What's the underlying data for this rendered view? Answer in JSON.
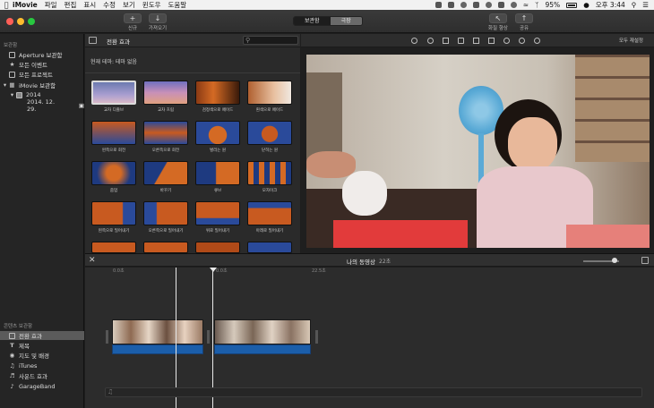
{
  "menubar": {
    "app_name": "iMovie",
    "items": [
      "파일",
      "편집",
      "표시",
      "수정",
      "보기",
      "윈도우",
      "도움말"
    ],
    "battery": "95%",
    "clock": "오후 3:44"
  },
  "toolbar": {
    "new_label": "신규",
    "import_label": "가져오기",
    "library_tab": "보관함",
    "theater_tab": "극장",
    "enhance_label": "화질 향상",
    "share_label": "공유"
  },
  "sidebar": {
    "library_header": "보관함",
    "items": [
      {
        "label": "Aperture 보관함"
      },
      {
        "label": "모든 이벤트"
      },
      {
        "label": "모든 프로젝트"
      },
      {
        "label": "iMovie 보관함"
      },
      {
        "label": "2014"
      },
      {
        "label": "2014. 12. 29."
      }
    ],
    "content_header": "콘텐츠 보관함",
    "content_items": [
      {
        "label": "전환 효과"
      },
      {
        "label": "제목"
      },
      {
        "label": "지도 및 배경"
      },
      {
        "label": "iTunes"
      },
      {
        "label": "사운드 효과"
      },
      {
        "label": "GarageBand"
      }
    ]
  },
  "browser": {
    "title": "전환 효과",
    "theme_text": "현재 테마: 테마 없음",
    "tiles": [
      {
        "label": "교차 디졸브"
      },
      {
        "label": "교차 흐림"
      },
      {
        "label": "검정색으로 페이드"
      },
      {
        "label": "흰색으로 페이드"
      },
      {
        "label": "왼쪽으로 회전"
      },
      {
        "label": "오른쪽으로 회전"
      },
      {
        "label": "벌리는 원"
      },
      {
        "label": "닫히는 원"
      },
      {
        "label": "줌업"
      },
      {
        "label": "바꾸기"
      },
      {
        "label": "큐브"
      },
      {
        "label": "모자이크"
      },
      {
        "label": "왼쪽으로 밀어내기"
      },
      {
        "label": "오른쪽으로 밀어내기"
      },
      {
        "label": "위로 밀어내기"
      },
      {
        "label": "아래로 밀어내기"
      }
    ]
  },
  "viewer": {
    "reset_label": "모두 재설정"
  },
  "timeline": {
    "project_title": "나의 동영상",
    "duration": "22초",
    "ruler": [
      "0.0초",
      "0.0초",
      "22.5초"
    ]
  },
  "colors": {
    "accent_audio": "#1b5eaa",
    "close": "#ff5f57",
    "minimize": "#febc2e",
    "zoom": "#28c840"
  }
}
